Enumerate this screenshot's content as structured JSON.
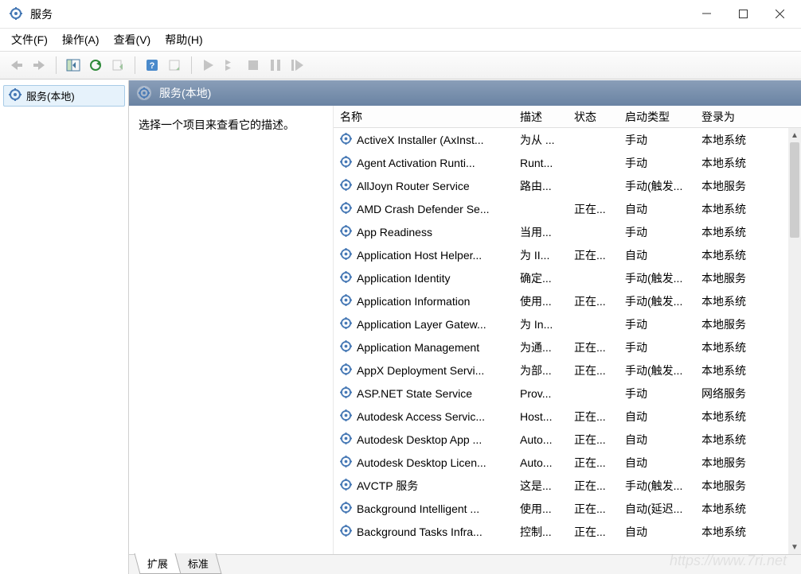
{
  "title": "服务",
  "menubar": {
    "file": "文件(F)",
    "action": "操作(A)",
    "view": "查看(V)",
    "help": "帮助(H)"
  },
  "sidebar": {
    "local_services": "服务(本地)"
  },
  "content": {
    "header": "服务(本地)",
    "desc_prompt": "选择一个项目来查看它的描述。"
  },
  "columns": {
    "name": "名称",
    "desc": "描述",
    "status": "状态",
    "startup": "启动类型",
    "logon": "登录为"
  },
  "tabs": {
    "extended": "扩展",
    "standard": "标准"
  },
  "services": [
    {
      "name": "ActiveX Installer (AxInst...",
      "desc": "为从 ...",
      "status": "",
      "startup": "手动",
      "logon": "本地系统"
    },
    {
      "name": "Agent Activation Runti...",
      "desc": "Runt...",
      "status": "",
      "startup": "手动",
      "logon": "本地系统"
    },
    {
      "name": "AllJoyn Router Service",
      "desc": "路由...",
      "status": "",
      "startup": "手动(触发...",
      "logon": "本地服务"
    },
    {
      "name": "AMD Crash Defender Se...",
      "desc": "",
      "status": "正在...",
      "startup": "自动",
      "logon": "本地系统"
    },
    {
      "name": "App Readiness",
      "desc": "当用...",
      "status": "",
      "startup": "手动",
      "logon": "本地系统"
    },
    {
      "name": "Application Host Helper...",
      "desc": "为 II...",
      "status": "正在...",
      "startup": "自动",
      "logon": "本地系统"
    },
    {
      "name": "Application Identity",
      "desc": "确定...",
      "status": "",
      "startup": "手动(触发...",
      "logon": "本地服务"
    },
    {
      "name": "Application Information",
      "desc": "使用...",
      "status": "正在...",
      "startup": "手动(触发...",
      "logon": "本地系统"
    },
    {
      "name": "Application Layer Gatew...",
      "desc": "为 In...",
      "status": "",
      "startup": "手动",
      "logon": "本地服务"
    },
    {
      "name": "Application Management",
      "desc": "为通...",
      "status": "正在...",
      "startup": "手动",
      "logon": "本地系统"
    },
    {
      "name": "AppX Deployment Servi...",
      "desc": "为部...",
      "status": "正在...",
      "startup": "手动(触发...",
      "logon": "本地系统"
    },
    {
      "name": "ASP.NET State Service",
      "desc": "Prov...",
      "status": "",
      "startup": "手动",
      "logon": "网络服务"
    },
    {
      "name": "Autodesk Access Servic...",
      "desc": "Host...",
      "status": "正在...",
      "startup": "自动",
      "logon": "本地系统"
    },
    {
      "name": "Autodesk Desktop App ...",
      "desc": "Auto...",
      "status": "正在...",
      "startup": "自动",
      "logon": "本地系统"
    },
    {
      "name": "Autodesk Desktop Licen...",
      "desc": "Auto...",
      "status": "正在...",
      "startup": "自动",
      "logon": "本地服务"
    },
    {
      "name": "AVCTP 服务",
      "desc": "这是...",
      "status": "正在...",
      "startup": "手动(触发...",
      "logon": "本地服务"
    },
    {
      "name": "Background Intelligent ...",
      "desc": "使用...",
      "status": "正在...",
      "startup": "自动(延迟...",
      "logon": "本地系统"
    },
    {
      "name": "Background Tasks Infra...",
      "desc": "控制...",
      "status": "正在...",
      "startup": "自动",
      "logon": "本地系统"
    }
  ],
  "watermark": "https://www.7ri.net"
}
